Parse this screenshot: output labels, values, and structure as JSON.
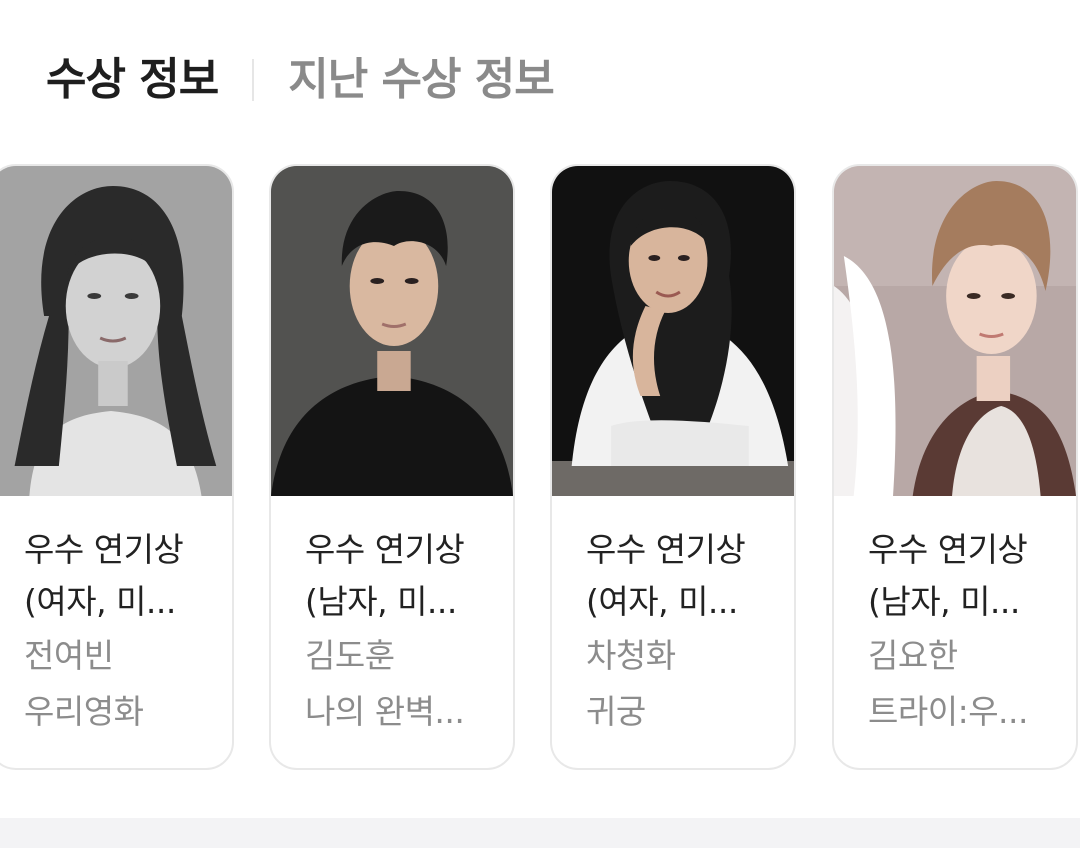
{
  "tabs": {
    "current": "수상 정보",
    "past": "지난 수상 정보"
  },
  "cards": [
    {
      "award_line1": "우수 연기상",
      "award_line2": "(여자, 미...",
      "name": "전여빈",
      "work": "우리영화",
      "photo_alt": "person-photo"
    },
    {
      "award_line1": "우수 연기상",
      "award_line2": "(남자, 미...",
      "name": "김도훈",
      "work": "나의 완벽...",
      "photo_alt": "person-photo"
    },
    {
      "award_line1": "우수 연기상",
      "award_line2": "(여자, 미...",
      "name": "차청화",
      "work": "귀궁",
      "photo_alt": "person-photo"
    },
    {
      "award_line1": "우수 연기상",
      "award_line2": "(남자, 미...",
      "name": "김요한",
      "work": "트라이:우...",
      "photo_alt": "person-photo"
    }
  ]
}
